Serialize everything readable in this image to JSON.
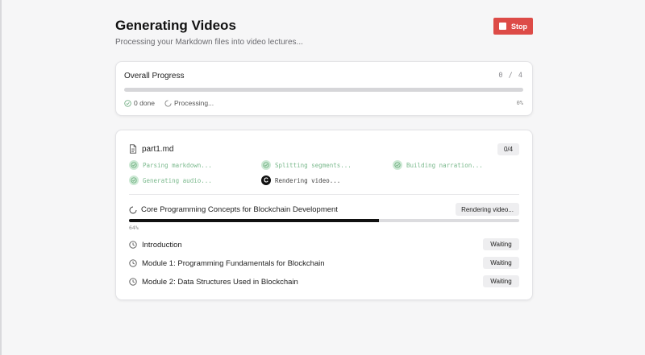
{
  "header": {
    "title": "Generating Videos",
    "subtitle": "Processing your Markdown files into video lectures...",
    "stop_label": "Stop"
  },
  "overall": {
    "title": "Overall Progress",
    "count": "0 / 4",
    "done_label": "0 done",
    "processing_label": "Processing...",
    "percent_label": "0%",
    "progress": 0
  },
  "file": {
    "name": "part1.md",
    "badge": "0/4",
    "steps": [
      {
        "label": "Parsing markdown...",
        "status": "done"
      },
      {
        "label": "Splitting segments...",
        "status": "done"
      },
      {
        "label": "Building narration...",
        "status": "done"
      },
      {
        "label": "Generating audio...",
        "status": "done"
      },
      {
        "label": "Rendering video...",
        "status": "active",
        "badge_letter": "C"
      }
    ],
    "active_segment": {
      "title": "Core Programming Concepts for Blockchain Development",
      "status": "Rendering video...",
      "percent_label": "64%",
      "progress": 0.64
    },
    "segments": [
      {
        "title": "Introduction",
        "status": "Waiting"
      },
      {
        "title": "Module 1: Programming Fundamentals for Blockchain",
        "status": "Waiting"
      },
      {
        "title": "Module 2: Data Structures Used in Blockchain",
        "status": "Waiting"
      }
    ]
  },
  "colors": {
    "stop": "#dd4b47",
    "done_green": "#7bb98d",
    "progress_dark": "#111111"
  },
  "icons": {
    "stop": "stop-square-icon",
    "done": "check-circle-icon",
    "processing": "spinner-icon",
    "file": "file-icon",
    "waiting": "clock-icon"
  }
}
